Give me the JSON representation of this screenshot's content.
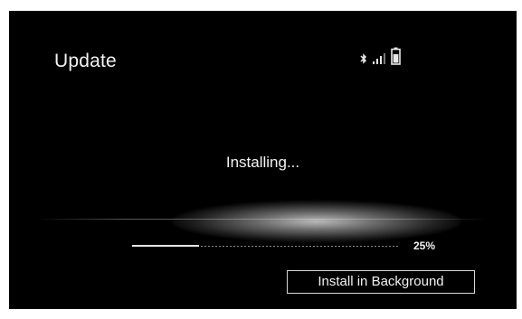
{
  "header": {
    "title": "Update"
  },
  "status_bar": {
    "icons": [
      "bluetooth-icon",
      "signal-strength-icon",
      "battery-icon"
    ]
  },
  "main": {
    "message": "Installing...",
    "progress": {
      "percent": 25,
      "label": "25%"
    },
    "background_button_label": "Install in Background"
  },
  "colors": {
    "background": "#000000",
    "text": "#f2f2f2",
    "border": "#d8d8d8"
  }
}
